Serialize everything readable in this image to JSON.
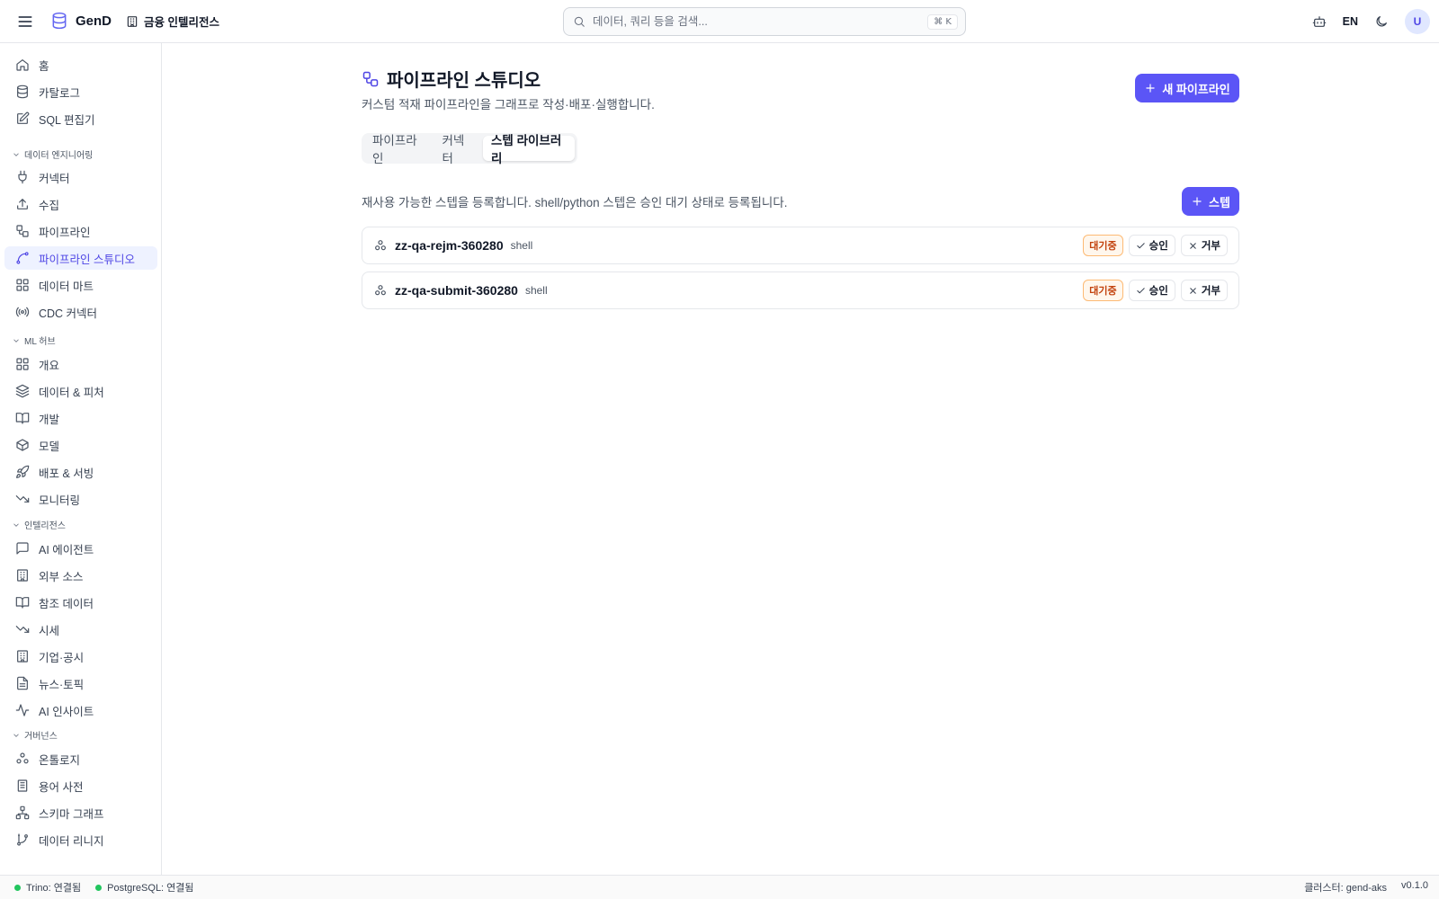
{
  "header": {
    "brand": "GenD",
    "workspace": "금융 인텔리전스",
    "search_placeholder": "데이터, 쿼리 등을 검색...",
    "search_shortcut": "⌘ K",
    "lang": "EN",
    "avatar": "U"
  },
  "sidebar": {
    "top_items": [
      {
        "label": "홈",
        "icon": "home-icon"
      },
      {
        "label": "카탈로그",
        "icon": "database-icon"
      },
      {
        "label": "SQL 편집기",
        "icon": "edit-icon"
      }
    ],
    "groups": [
      {
        "label": "데이터 엔지니어링",
        "items": [
          {
            "label": "커넥터",
            "icon": "plug-icon"
          },
          {
            "label": "수집",
            "icon": "upload-icon"
          },
          {
            "label": "파이프라인",
            "icon": "workflow-icon"
          },
          {
            "label": "파이프라인 스튜디오",
            "icon": "spline-icon",
            "active": true
          },
          {
            "label": "데이터 마트",
            "icon": "grid-icon"
          },
          {
            "label": "CDC 커넥터",
            "icon": "radio-icon"
          }
        ]
      },
      {
        "label": "ML 허브",
        "items": [
          {
            "label": "개요",
            "icon": "grid-icon"
          },
          {
            "label": "데이터 & 피처",
            "icon": "layers-icon"
          },
          {
            "label": "개발",
            "icon": "book-open-icon"
          },
          {
            "label": "모델",
            "icon": "box-icon"
          },
          {
            "label": "배포 & 서빙",
            "icon": "rocket-icon"
          },
          {
            "label": "모니터링",
            "icon": "trending-down-icon"
          }
        ]
      },
      {
        "label": "인텔리전스",
        "items": [
          {
            "label": "AI 에이전트",
            "icon": "message-square-icon"
          },
          {
            "label": "외부 소스",
            "icon": "building-icon"
          },
          {
            "label": "참조 데이터",
            "icon": "book-open-icon"
          },
          {
            "label": "시세",
            "icon": "trending-down-icon"
          },
          {
            "label": "기업·공시",
            "icon": "building-icon"
          },
          {
            "label": "뉴스·토픽",
            "icon": "file-text-icon"
          },
          {
            "label": "AI 인사이트",
            "icon": "activity-icon"
          }
        ]
      },
      {
        "label": "거버넌스",
        "items": [
          {
            "label": "온톨로지",
            "icon": "boxes-icon"
          },
          {
            "label": "용어 사전",
            "icon": "document-icon"
          },
          {
            "label": "스키마 그래프",
            "icon": "network-icon"
          },
          {
            "label": "데이터 리니지",
            "icon": "git-branch-icon"
          }
        ]
      }
    ]
  },
  "page": {
    "title": "파이프라인 스튜디오",
    "subtitle": "커스텀 적재 파이프라인을 그래프로 작성·배포·실행합니다.",
    "new_button": "새 파이프라인",
    "tabs": [
      "파이프라인",
      "커넥터",
      "스텝 라이브러리"
    ],
    "active_tab": 2,
    "description": "재사용 가능한 스텝을 등록합니다. shell/python 스텝은 승인 대기 상태로 등록됩니다.",
    "add_step_button": "스텝",
    "steps": [
      {
        "name": "zz-qa-rejm-360280",
        "type": "shell",
        "status": "대기중",
        "approve": "승인",
        "reject": "거부"
      },
      {
        "name": "zz-qa-submit-360280",
        "type": "shell",
        "status": "대기중",
        "approve": "승인",
        "reject": "거부"
      }
    ]
  },
  "footer": {
    "statuses": [
      {
        "label": "Trino: 연결됨",
        "color": "#22c55e"
      },
      {
        "label": "PostgreSQL: 연결됨",
        "color": "#22c55e"
      }
    ],
    "cluster": "클러스터: gend-aks",
    "version": "v0.1.0"
  },
  "colors": {
    "accent": "#5b55f6",
    "pending": "#c2410c"
  }
}
